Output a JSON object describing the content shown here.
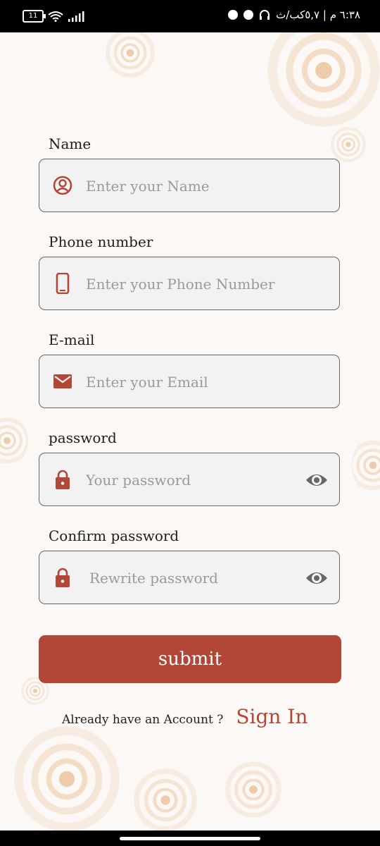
{
  "status_bar": {
    "battery": "11",
    "right_text": "٦:٣٨ م | ٥,٧كب/ث"
  },
  "form": {
    "name": {
      "label": "Name",
      "placeholder": "Enter your Name",
      "icon": "user-circle-icon"
    },
    "phone": {
      "label": "Phone number",
      "placeholder": "Enter your Phone Number",
      "icon": "phone-icon"
    },
    "email": {
      "label": "E-mail",
      "placeholder": "Enter your Email",
      "icon": "mail-icon"
    },
    "password": {
      "label": "password",
      "placeholder": "Your password",
      "icon": "lock-icon"
    },
    "confirm": {
      "label": "Confirm password",
      "placeholder": "Rewrite password",
      "icon": "lock-icon"
    },
    "submit_label": "submit"
  },
  "footer": {
    "already_text": "Already have an Account ?",
    "signin_label": "Sign In"
  },
  "colors": {
    "accent": "#b24738",
    "field_bg": "#f2f2f2",
    "background": "#fbf8f5"
  }
}
